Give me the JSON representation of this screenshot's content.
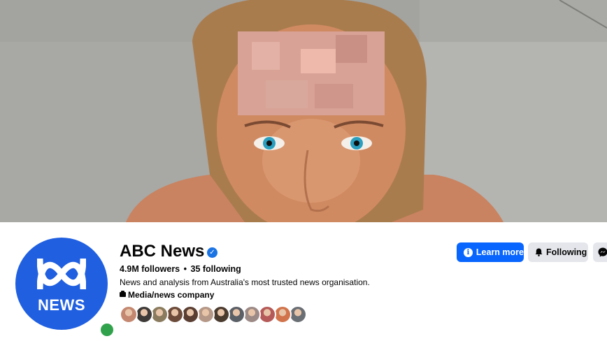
{
  "cover": {
    "description_icon": "cover-photo"
  },
  "page": {
    "logo_text": "NEWS",
    "name": "ABC News",
    "verified_icon": "verified-badge-icon",
    "followers": "4.9M followers",
    "separator": "•",
    "following": "35 following",
    "bio": "News and analysis from Australia's most trusted news organisation.",
    "category": "Media/news company",
    "category_icon": "briefcase-icon",
    "online_status_color": "#31a24c",
    "brand_color": "#1f5fe0"
  },
  "actions": {
    "learn_more": "Learn more",
    "following": "Following",
    "learn_more_icon": "info-icon",
    "following_icon": "bell-icon",
    "message_icon": "messenger-icon",
    "primary_color": "#0866ff"
  },
  "friends_who_follow": {
    "avatar_colors": [
      "#c48870",
      "#3d3a38",
      "#8a7b5e",
      "#6c4b3a",
      "#5a3e32",
      "#b59887",
      "#4a3b2f",
      "#5b5f66",
      "#9c8a86",
      "#b55a58",
      "#d1744c",
      "#6a6f75"
    ]
  }
}
